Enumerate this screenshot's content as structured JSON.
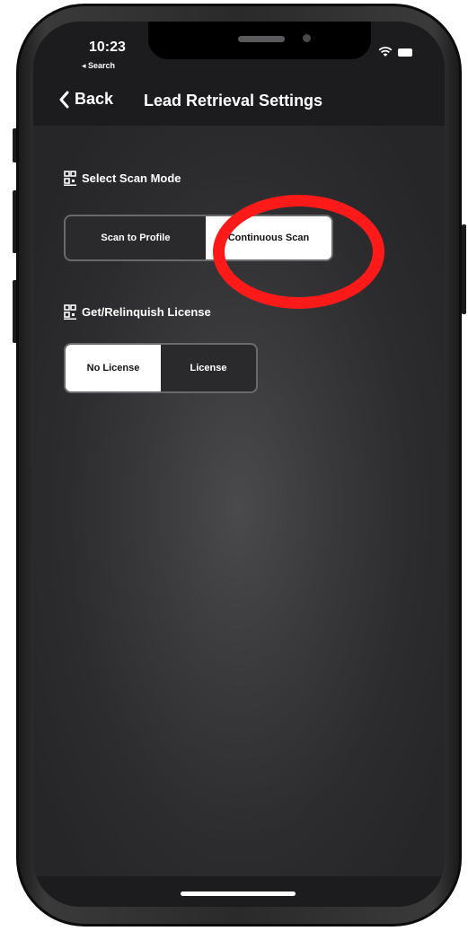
{
  "status_bar": {
    "time": "10:23",
    "back_to_app": "◂ Search"
  },
  "nav": {
    "back_label": "Back",
    "title": "Lead Retrieval Settings"
  },
  "scan_mode": {
    "header": "Select Scan Mode",
    "options": [
      {
        "label": "Scan to Profile",
        "selected": false
      },
      {
        "label": "Continuous Scan",
        "selected": true
      }
    ]
  },
  "license": {
    "header": "Get/Relinquish License",
    "options": [
      {
        "label": "No License",
        "selected": true
      },
      {
        "label": "License",
        "selected": false
      }
    ]
  },
  "icons": {
    "back": "chevron-left-icon",
    "section": "qr-code-icon",
    "wifi": "wifi-icon",
    "battery": "battery-icon"
  },
  "colors": {
    "annotation": "#ff1a1a",
    "nav_bar": "#1c1c1e",
    "selected_segment": "#ffffff"
  }
}
